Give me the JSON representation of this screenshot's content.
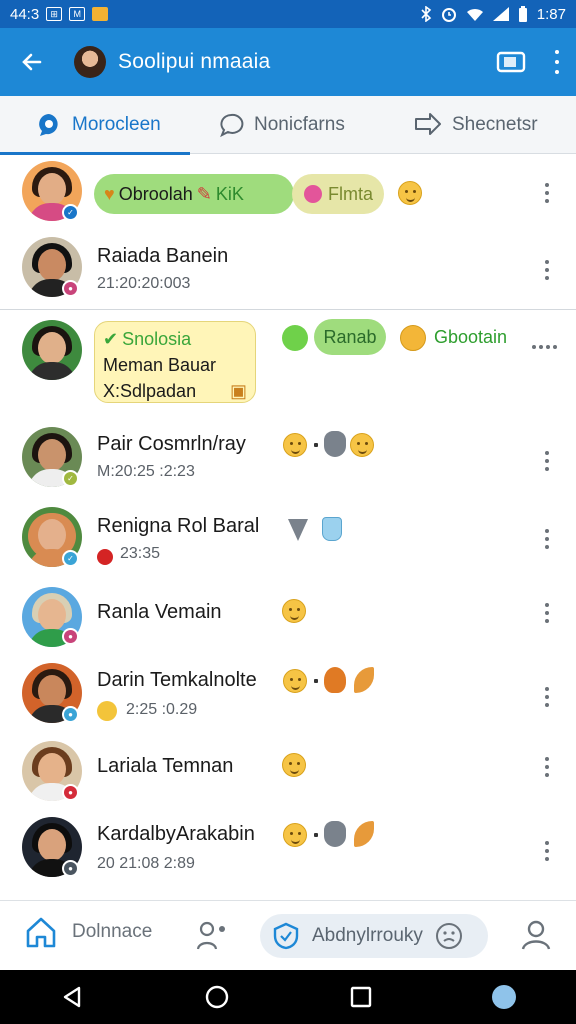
{
  "status": {
    "time_left": "44:3",
    "time_right": "1:87",
    "mini_icon": "⊞",
    "mini_icon2": "M"
  },
  "header": {
    "title": "Soolipui nmaaia"
  },
  "tabs": [
    {
      "label": "Morocleen",
      "icon": "chat-bubble-icon",
      "active": true
    },
    {
      "label": "Nonicfarns",
      "icon": "speech-bubble-icon",
      "active": false
    },
    {
      "label": "Shecnetsr",
      "icon": "share-arrow-icon",
      "active": false
    }
  ],
  "chats": [
    {
      "pill1": "Obroolah",
      "pill1_tag": "KiK",
      "pill2": "Flmta"
    },
    {
      "name": "Raiada Banein",
      "time": "21:20:20:003"
    },
    {
      "bubble_title": "Snolosia",
      "bubble_line2": "Meman Bauar",
      "bubble_line3": "X:Sdlpadan",
      "pill": "Ranab",
      "green_text": "Gbootain"
    },
    {
      "name": "Pair Cosmrln/ray",
      "time": "M:20:25 :2:23"
    },
    {
      "name": "Renigna Rol Baral",
      "time": "23:35"
    },
    {
      "name": "Ranla Vemain"
    },
    {
      "name": "Darin Temkalnolte",
      "time": "2:25 :0.29"
    },
    {
      "name": "Lariala Temnan"
    },
    {
      "name": "KardalbyArakabin",
      "time": "20 21:08 2:89"
    }
  ],
  "bottom_nav": {
    "home_label": "Dolnnace",
    "search_label": "Abdnylrrouky"
  },
  "colors": {
    "status": "#1363b8",
    "appbar": "#1e88d6",
    "accent": "#1976c9",
    "green_pill": "#9fdc7d",
    "bubble_yellow": "#fff5b8"
  }
}
